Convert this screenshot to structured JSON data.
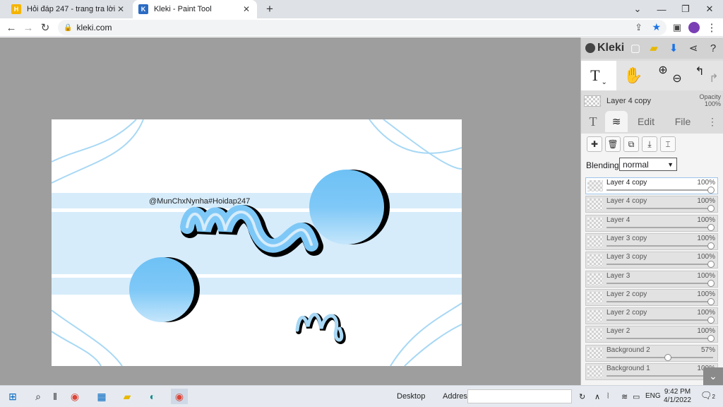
{
  "browser": {
    "tabs": [
      {
        "title": "Hỏi đáp 247 - trang tra lời",
        "icon": "hoidap-favicon"
      },
      {
        "title": "Kleki - Paint Tool",
        "icon": "kleki-favicon"
      }
    ],
    "new_tab": "+",
    "url": "kleki.com"
  },
  "canvas": {
    "watermark": "@MunChxNynha#Hoidap247",
    "colors": {
      "stripe": "#d6ecfb",
      "circle_top": "#6ec1f5",
      "circle_bottom": "#c5e6fb",
      "line": "#a8d8f5"
    }
  },
  "panel": {
    "logo": "Kleki",
    "current_layer": "Layer 4 copy",
    "opacity_label": "Opacity",
    "opacity_value": "100%",
    "tabs": {
      "edit": "Edit",
      "file": "File"
    },
    "blending_label": "Blending",
    "blending_value": "normal",
    "layers": [
      {
        "name": "Layer 4 copy",
        "opacity": "100%",
        "level": 1.0,
        "active": true
      },
      {
        "name": "Layer 4 copy",
        "opacity": "100%",
        "level": 1.0
      },
      {
        "name": "Layer 4",
        "opacity": "100%",
        "level": 1.0
      },
      {
        "name": "Layer 3 copy",
        "opacity": "100%",
        "level": 1.0
      },
      {
        "name": "Layer 3 copy",
        "opacity": "100%",
        "level": 1.0
      },
      {
        "name": "Layer 3",
        "opacity": "100%",
        "level": 1.0
      },
      {
        "name": "Layer 2 copy",
        "opacity": "100%",
        "level": 1.0
      },
      {
        "name": "Layer 2 copy",
        "opacity": "100%",
        "level": 1.0
      },
      {
        "name": "Layer 2",
        "opacity": "100%",
        "level": 1.0
      },
      {
        "name": "Background 2",
        "opacity": "57%",
        "level": 0.57
      },
      {
        "name": "Background 1",
        "opacity": "100%",
        "level": 1.0
      }
    ]
  },
  "taskbar": {
    "desktop": "Desktop",
    "address": "Address",
    "language": "ENG",
    "time": "9:42 PM",
    "date": "4/1/2022",
    "notification_count": "2"
  }
}
